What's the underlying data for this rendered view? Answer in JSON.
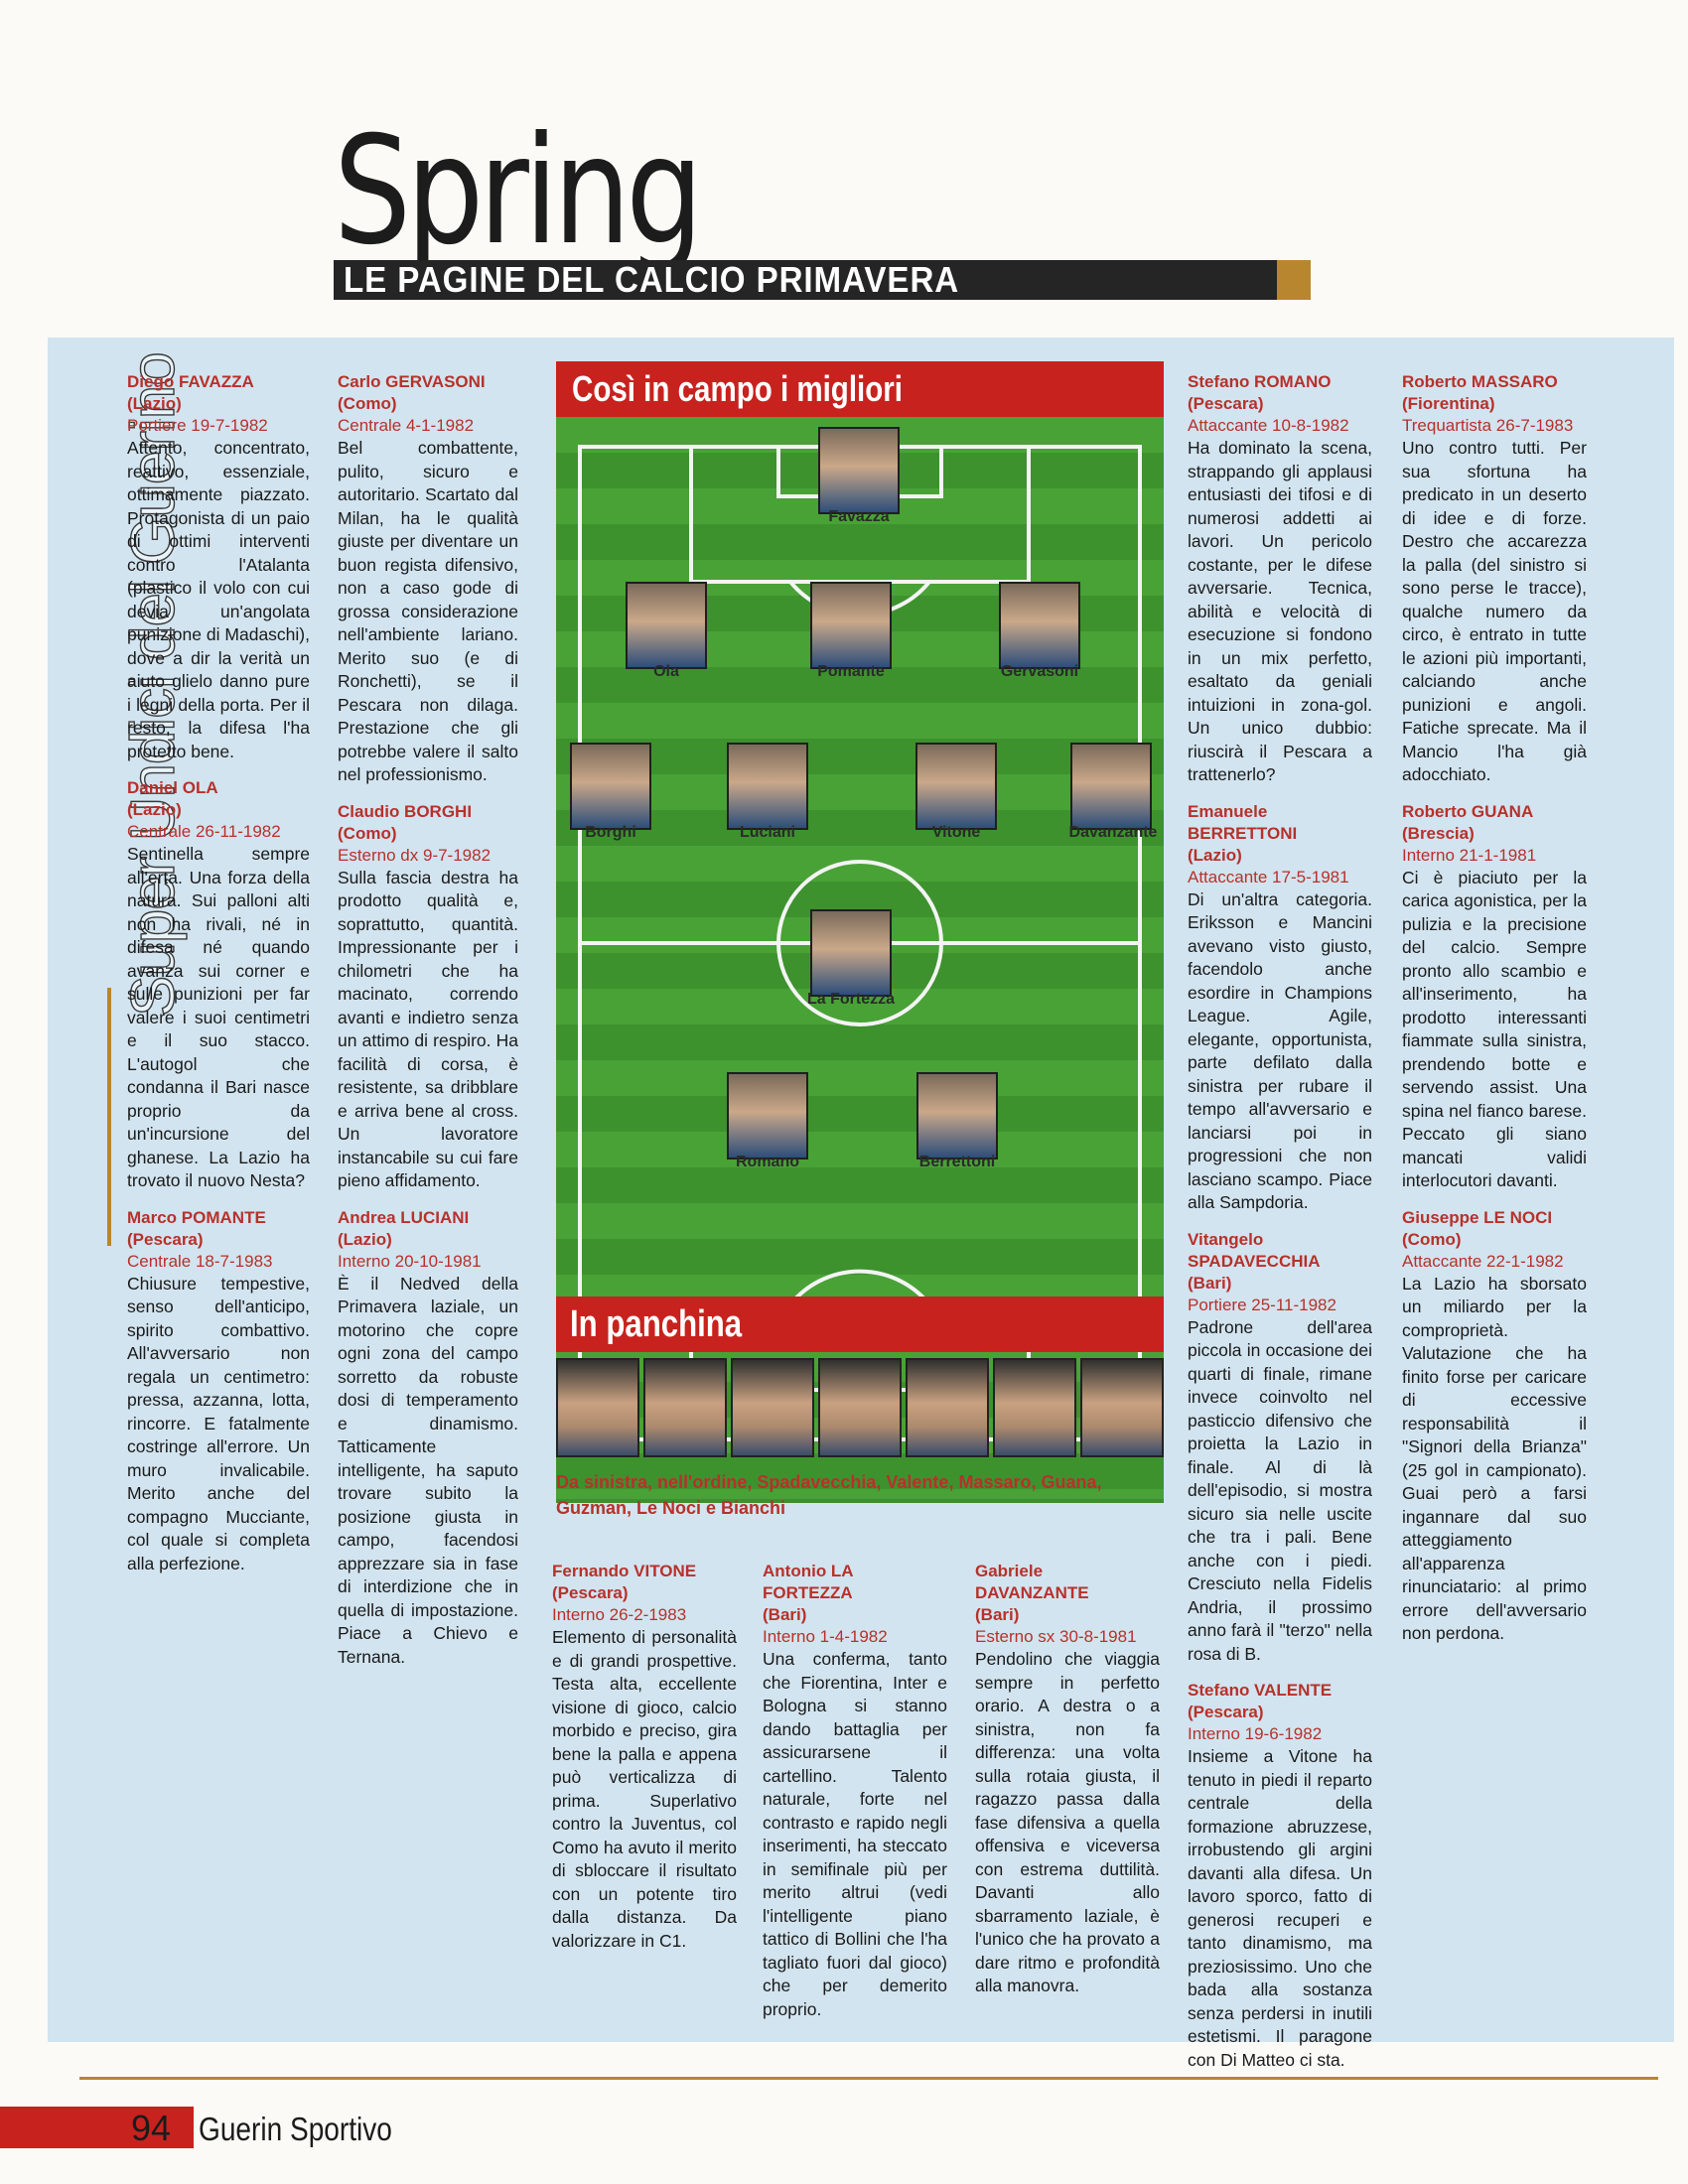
{
  "header": {
    "title": "Spring",
    "banner": "LE PAGINE DEL CALCIO PRIMAVERA",
    "section": "Super Undici del Guerino"
  },
  "field": {
    "heading": "Così in campo i migliori",
    "players": [
      "Favazza",
      "Ola",
      "Pomante",
      "Gervasoni",
      "Borghi",
      "Luciani",
      "Vitone",
      "Davanzante",
      "La Fortezza",
      "Romano",
      "Berrettoni"
    ]
  },
  "bench": {
    "heading": "In panchina",
    "caption": "Da sinistra, nell'ordine, Spadavecchia, Valente, Massaro, Guana, Guzman, Le Noci e Bianchi"
  },
  "profiles": [
    {
      "name": "Diego FAVAZZA",
      "team": "(Lazio)",
      "role": "Portiere 19-7-1982",
      "text": "Attento, concentrato, reattivo, essenziale, ottimamente piazzato. Protagonista di un paio di ottimi interventi contro l'Atalanta (plastico il volo con cui devia un'angolata punizione di Madaschi), dove a dir la verità un aiuto glielo danno pure i legni della porta. Per il resto, la difesa l'ha protetto bene."
    },
    {
      "name": "Daniel OLA",
      "team": "(Lazio)",
      "role": "Centrale 26-11-1982",
      "text": "Sentinella sempre all'erta. Una forza della natura. Sui palloni alti non ha rivali, né in difesa né quando avanza sui corner e sulle punizioni per far valere i suoi centimetri e il suo stacco. L'autogol che condanna il Bari nasce proprio da un'incursione del ghanese. La Lazio ha trovato il nuovo Nesta?"
    },
    {
      "name": "Marco POMANTE",
      "team": "(Pescara)",
      "role": "Centrale 18-7-1983",
      "text": "Chiusure tempestive, senso dell'anticipo, spirito combattivo. All'avversario non regala un centimetro: pressa, azzanna, lotta, rincorre. E fatalmente costringe all'errore. Un muro invalicabile. Merito anche del compagno Mucciante, col quale si completa alla perfezione."
    },
    {
      "name": "Carlo GERVASONI",
      "team": "(Como)",
      "role": "Centrale 4-1-1982",
      "text": "Bel combattente, pulito, sicuro e autoritario. Scartato dal Milan, ha le qualità giuste per diventare un buon regista difensivo, non a caso gode di grossa considerazione nell'ambiente lariano. Merito suo (e di Ronchetti), se il Pescara non dilaga. Prestazione che gli potrebbe valere il salto nel professionismo."
    },
    {
      "name": "Claudio BORGHI",
      "team": "(Como)",
      "role": "Esterno dx 9-7-1982",
      "text": "Sulla fascia destra ha prodotto qualità e, soprattutto, quantità. Impressionante per i chilometri che ha macinato, correndo avanti e indietro senza un attimo di respiro. Ha facilità di corsa, è resistente, sa dribblare e arriva bene al cross. Un lavoratore instancabile su cui fare pieno affidamento."
    },
    {
      "name": "Andrea LUCIANI",
      "team": "(Lazio)",
      "role": "Interno 20-10-1981",
      "text": "È il Nedved della Primavera laziale, un motorino che copre ogni zona del campo sorretto da robuste dosi di temperamento e dinamismo. Tatticamente intelligente, ha saputo trovare subito la posizione giusta in campo, facendosi apprezzare sia in fase di interdizione che in quella di impostazione. Piace a Chievo e Ternana."
    },
    {
      "name": "Fernando VITONE",
      "team": "(Pescara)",
      "role": "Interno 26-2-1983",
      "text": "Elemento di personalità e di grandi prospettive. Testa alta, eccellente visione di gioco, calcio morbido e preciso, gira bene la palla e appena può verticalizza di prima. Superlativo contro la Juventus, col Como ha avuto il merito di sbloccare il risultato con un potente tiro dalla distanza. Da valorizzare in C1."
    },
    {
      "name": "Antonio LA FORTEZZA",
      "team": "(Bari)",
      "role": "Interno 1-4-1982",
      "text": "Una conferma, tanto che Fiorentina, Inter e Bologna si stanno dando battaglia per assicurarsene il cartellino. Talento naturale, forte nel contrasto e rapido negli inserimenti, ha steccato in semifinale più per merito altrui (vedi l'intelligente piano tattico di Bollini che l'ha tagliato fuori dal gioco) che per demerito proprio."
    },
    {
      "name": "Gabriele DAVANZANTE",
      "team": "(Bari)",
      "role": "Esterno sx 30-8-1981",
      "text": "Pendolino che viaggia sempre in perfetto orario. A destra o a sinistra, non fa differenza: una volta sulla rotaia giusta, il ragazzo passa dalla fase difensiva a quella offensiva e viceversa con estrema duttilità. Davanti allo sbarramento laziale, è l'unico che ha provato a dare ritmo e profondità alla manovra."
    },
    {
      "name": "Stefano ROMANO",
      "team": "(Pescara)",
      "role": "Attaccante 10-8-1982",
      "text": "Ha dominato la scena, strappando gli applausi entusiasti dei tifosi e di numerosi addetti ai lavori. Un pericolo costante, per le difese avversarie. Tecnica, abilità e velocità di esecuzione si fondono in un mix perfetto, esaltato da geniali intuizioni in zona-gol. Un unico dubbio: riuscirà il Pescara a trattenerlo?"
    },
    {
      "name": "Emanuele BERRETTONI",
      "team": "(Lazio)",
      "role": "Attaccante 17-5-1981",
      "text": "Di un'altra categoria. Eriksson e Mancini avevano visto giusto, facendolo anche esordire in Champions League. Agile, elegante, opportunista, parte defilato dalla sinistra per rubare il tempo all'avversario e lanciarsi poi in progressioni che non lasciano scampo. Piace alla Sampdoria."
    },
    {
      "name": "Vitangelo SPADAVECCHIA",
      "team": "(Bari)",
      "role": "Portiere 25-11-1982",
      "text": "Padrone dell'area piccola in occasione dei quarti di finale, rimane invece coinvolto nel pasticcio difensivo che proietta la Lazio in finale. Al di là dell'episodio, si mostra sicuro sia nelle uscite che tra i pali. Bene anche con i piedi. Cresciuto nella Fidelis Andria, il prossimo anno farà il \"terzo\" nella rosa di B."
    },
    {
      "name": "Stefano VALENTE",
      "team": "(Pescara)",
      "role": "Interno 19-6-1982",
      "text": "Insieme a Vitone ha tenuto in piedi il reparto centrale della formazione abruzzese, irrobustendo gli argini davanti alla difesa. Un lavoro sporco, fatto di generosi recuperi e tanto dinamismo, ma preziosissimo. Uno che bada alla sostanza senza perdersi in inutili estetismi. Il paragone con Di Matteo ci sta."
    },
    {
      "name": "Roberto MASSARO",
      "team": "(Fiorentina)",
      "role": "Trequartista 26-7-1983",
      "text": "Uno contro tutti. Per sua sfortuna ha predicato in un deserto di idee e di forze. Destro che accarezza la palla (del sinistro si sono perse le tracce), qualche numero da circo, è entrato in tutte le azioni più importanti, calciando anche punizioni e angoli. Fatiche sprecate. Ma il Mancio l'ha già adocchiato."
    },
    {
      "name": "Roberto GUANA",
      "team": "(Brescia)",
      "role": "Interno 21-1-1981",
      "text": "Ci è piaciuto per la carica agonistica, per la pulizia e la precisione del calcio. Sempre pronto allo scambio e all'inserimento, ha prodotto interessanti fiammate sulla sinistra, prendendo botte e servendo assist. Una spina nel fianco barese. Peccato gli siano mancati validi interlocutori davanti."
    },
    {
      "name": "Giuseppe LE NOCI",
      "team": "(Como)",
      "role": "Attaccante 22-1-1982",
      "text": "La Lazio ha sborsato un miliardo per la comproprietà. Valutazione che ha finito forse per caricare di eccessive responsabilità il \"Signori della Brianza\" (25 gol in campionato). Guai però a farsi ingannare dal suo atteggiamento all'apparenza rinunciatario: al primo errore dell'avversario non perdona."
    }
  ],
  "footer": {
    "page_number": "94",
    "magazine": "Guerin Sportivo"
  }
}
